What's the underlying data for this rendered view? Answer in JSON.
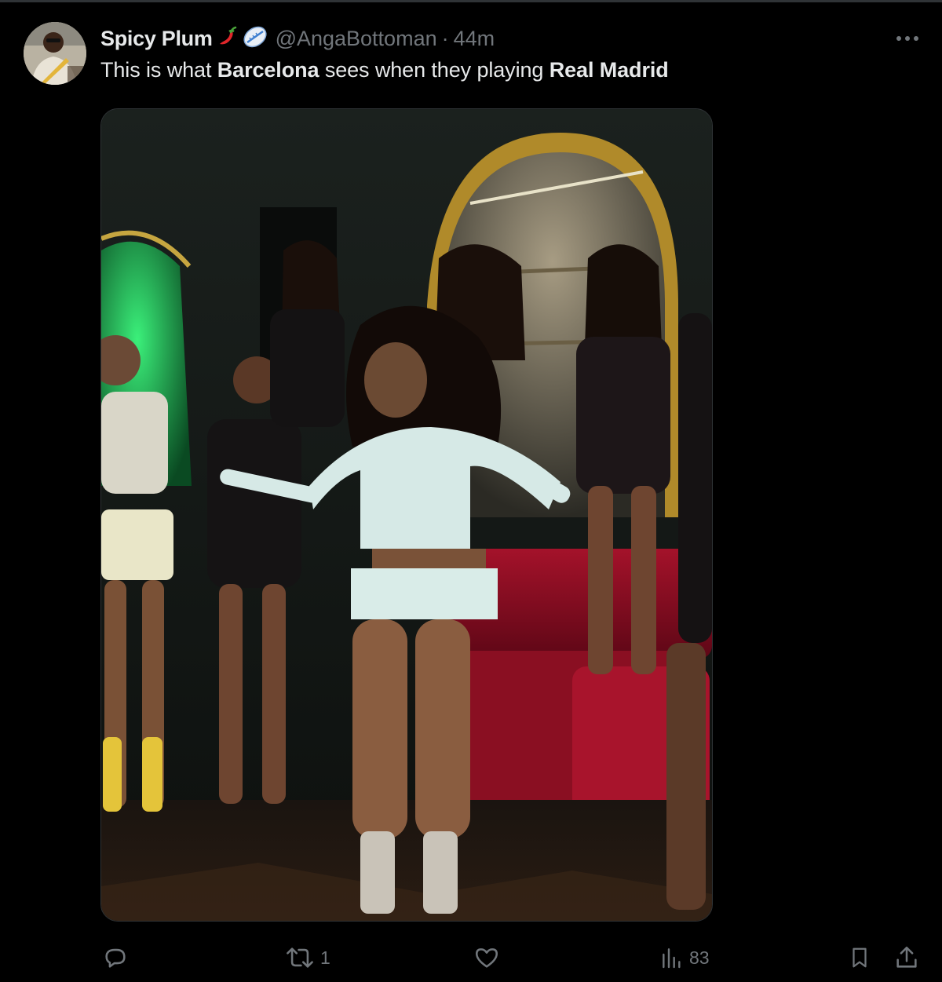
{
  "tweet": {
    "author": {
      "display_name": "Spicy Plum",
      "name_emojis": [
        "hot-pepper-icon",
        "rugby-ball-icon"
      ],
      "handle": "@AngaBottoman",
      "separator": "·",
      "time": "44m"
    },
    "text": {
      "part1": "This is what ",
      "bold1": "Barcelona",
      "part2": " sees when they playing ",
      "bold2": "Real Madrid"
    },
    "more_icon": "more-horizontal-icon",
    "media_description_icon": "video-thumbnail"
  },
  "actions": {
    "reply": {
      "icon": "reply-icon",
      "count": ""
    },
    "repost": {
      "icon": "repost-icon",
      "count": "1"
    },
    "like": {
      "icon": "heart-icon",
      "count": ""
    },
    "views": {
      "icon": "views-icon",
      "count": "83"
    },
    "bookmark": {
      "icon": "bookmark-icon"
    },
    "share": {
      "icon": "share-icon"
    }
  },
  "colors": {
    "background": "#000000",
    "text_primary": "#e7e9ea",
    "text_secondary": "#71767b",
    "border": "#2f3336"
  }
}
